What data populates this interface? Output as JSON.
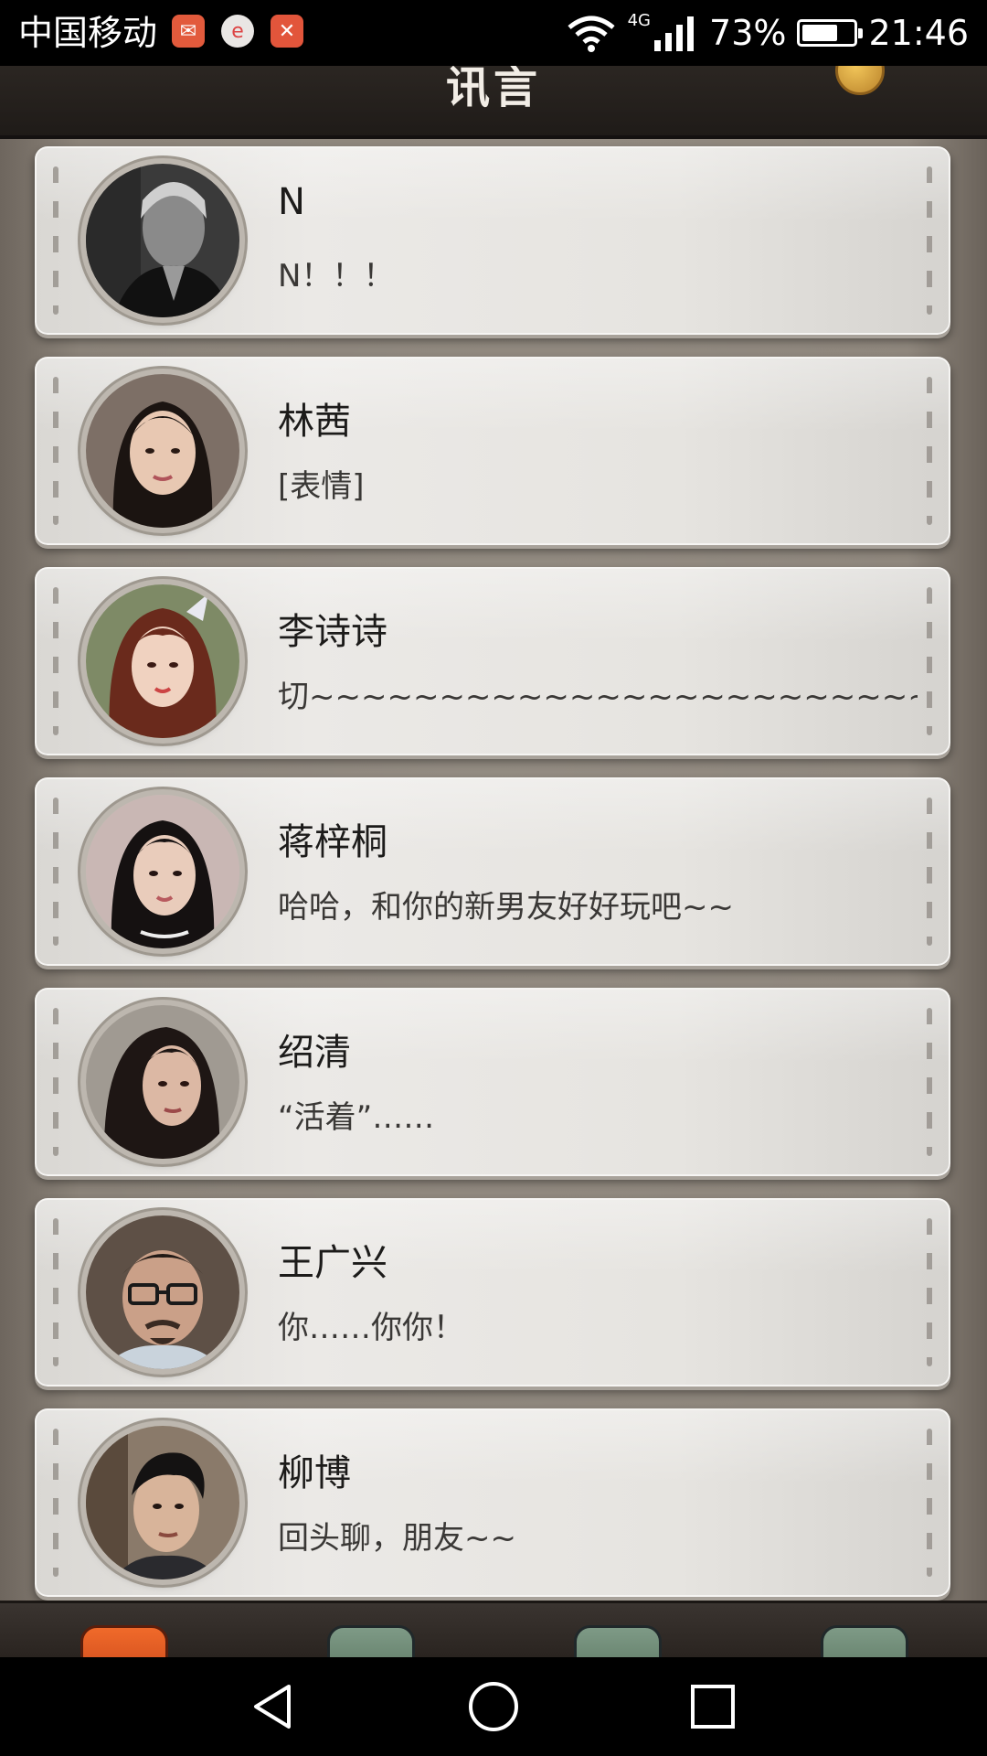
{
  "status_bar": {
    "carrier": "中国移动",
    "network_type": "4G",
    "battery_percent": "73%",
    "battery_level": 0.73,
    "time": "21:46",
    "notification_icons": [
      "mail-app-icon",
      "browser-app-icon",
      "tool-app-icon"
    ]
  },
  "header": {
    "title": "讯言"
  },
  "chats": [
    {
      "name": "N",
      "preview": "N！！！",
      "avatar": "avatar-man-bw"
    },
    {
      "name": "林茜",
      "preview": "[表情]",
      "avatar": "avatar-woman-dark-hair"
    },
    {
      "name": "李诗诗",
      "preview": "切~~~~~~~~~~~~~~~~~~~~~~~~~~…",
      "avatar": "avatar-woman-auburn-hair"
    },
    {
      "name": "蒋梓桐",
      "preview": "哈哈，和你的新男友好好玩吧~~",
      "avatar": "avatar-woman-black-hair"
    },
    {
      "name": "绍清",
      "preview": "“活着”……",
      "avatar": "avatar-woman-long-hair"
    },
    {
      "name": "王广兴",
      "preview": "你……你你！",
      "avatar": "avatar-man-glasses"
    },
    {
      "name": "柳博",
      "preview": "回头聊，朋友~~",
      "avatar": "avatar-man-young"
    }
  ],
  "tabs": [
    {
      "icon": "chat-tab-icon",
      "active": true
    },
    {
      "icon": "notes-tab-icon",
      "active": false
    },
    {
      "icon": "leaf-tab-icon",
      "active": false
    },
    {
      "icon": "settings-tab-icon",
      "active": false
    }
  ],
  "colors": {
    "active_tab": "#e8581f",
    "inactive_tab": "#6b8872",
    "card": "#e6e4e0",
    "background": "#8b8379"
  }
}
